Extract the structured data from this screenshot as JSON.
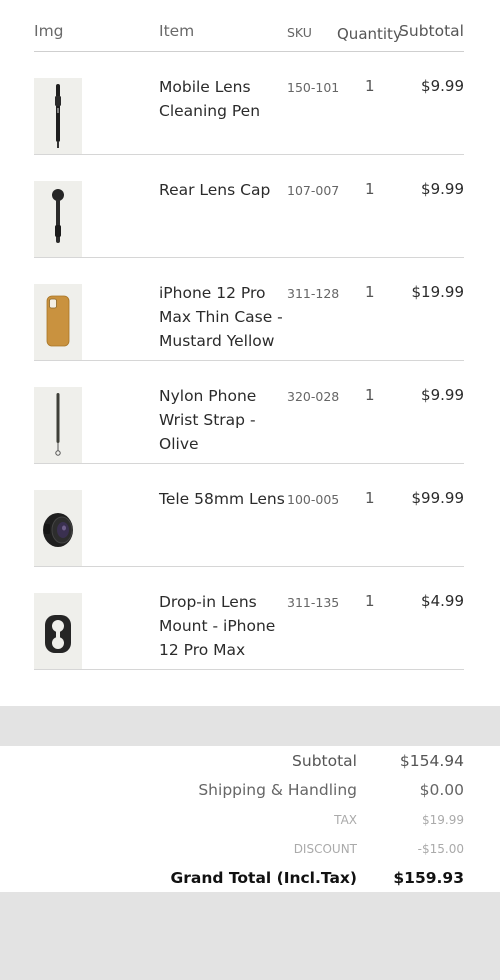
{
  "table": {
    "headers": {
      "img": "Img",
      "item": "Item",
      "sku": "SKU",
      "quantity": "Quantity",
      "subtotal": "Subtotal"
    },
    "rows": [
      {
        "name": "Mobile Lens Cleaning Pen",
        "sku": "150-101",
        "qty": "1",
        "price": "$9.99",
        "icon": "lens-pen-icon"
      },
      {
        "name": "Rear Lens Cap",
        "sku": "107-007",
        "qty": "1",
        "price": "$9.99",
        "icon": "lens-cap-icon"
      },
      {
        "name": "iPhone 12 Pro Max Thin Case - Mustard Yellow",
        "sku": "311-128",
        "qty": "1",
        "price": "$19.99",
        "icon": "phone-case-icon"
      },
      {
        "name": "Nylon Phone Wrist Strap - Olive",
        "sku": "320-028",
        "qty": "1",
        "price": "$9.99",
        "icon": "wrist-strap-icon"
      },
      {
        "name": "Tele 58mm Lens",
        "sku": "100-005",
        "qty": "1",
        "price": "$99.99",
        "icon": "tele-lens-icon"
      },
      {
        "name": "Drop-in Lens Mount - iPhone 12 Pro Max",
        "sku": "311-135",
        "qty": "1",
        "price": "$4.99",
        "icon": "lens-mount-icon"
      }
    ]
  },
  "totals": {
    "subtotal_label": "Subtotal",
    "subtotal_value": "$154.94",
    "shipping_label": "Shipping & Handling",
    "shipping_value": "$0.00",
    "tax_label": "TAX",
    "tax_value": "$19.99",
    "discount_label": "DISCOUNT",
    "discount_value": "-$15.00",
    "grand_label": "Grand Total (Incl.Tax)",
    "grand_value": "$159.93"
  },
  "colors": {
    "thumb_bg": "#efefeb",
    "mustard": "#c9923f",
    "olive": "#3e3f38",
    "gray_bar": "#e3e3e3"
  }
}
